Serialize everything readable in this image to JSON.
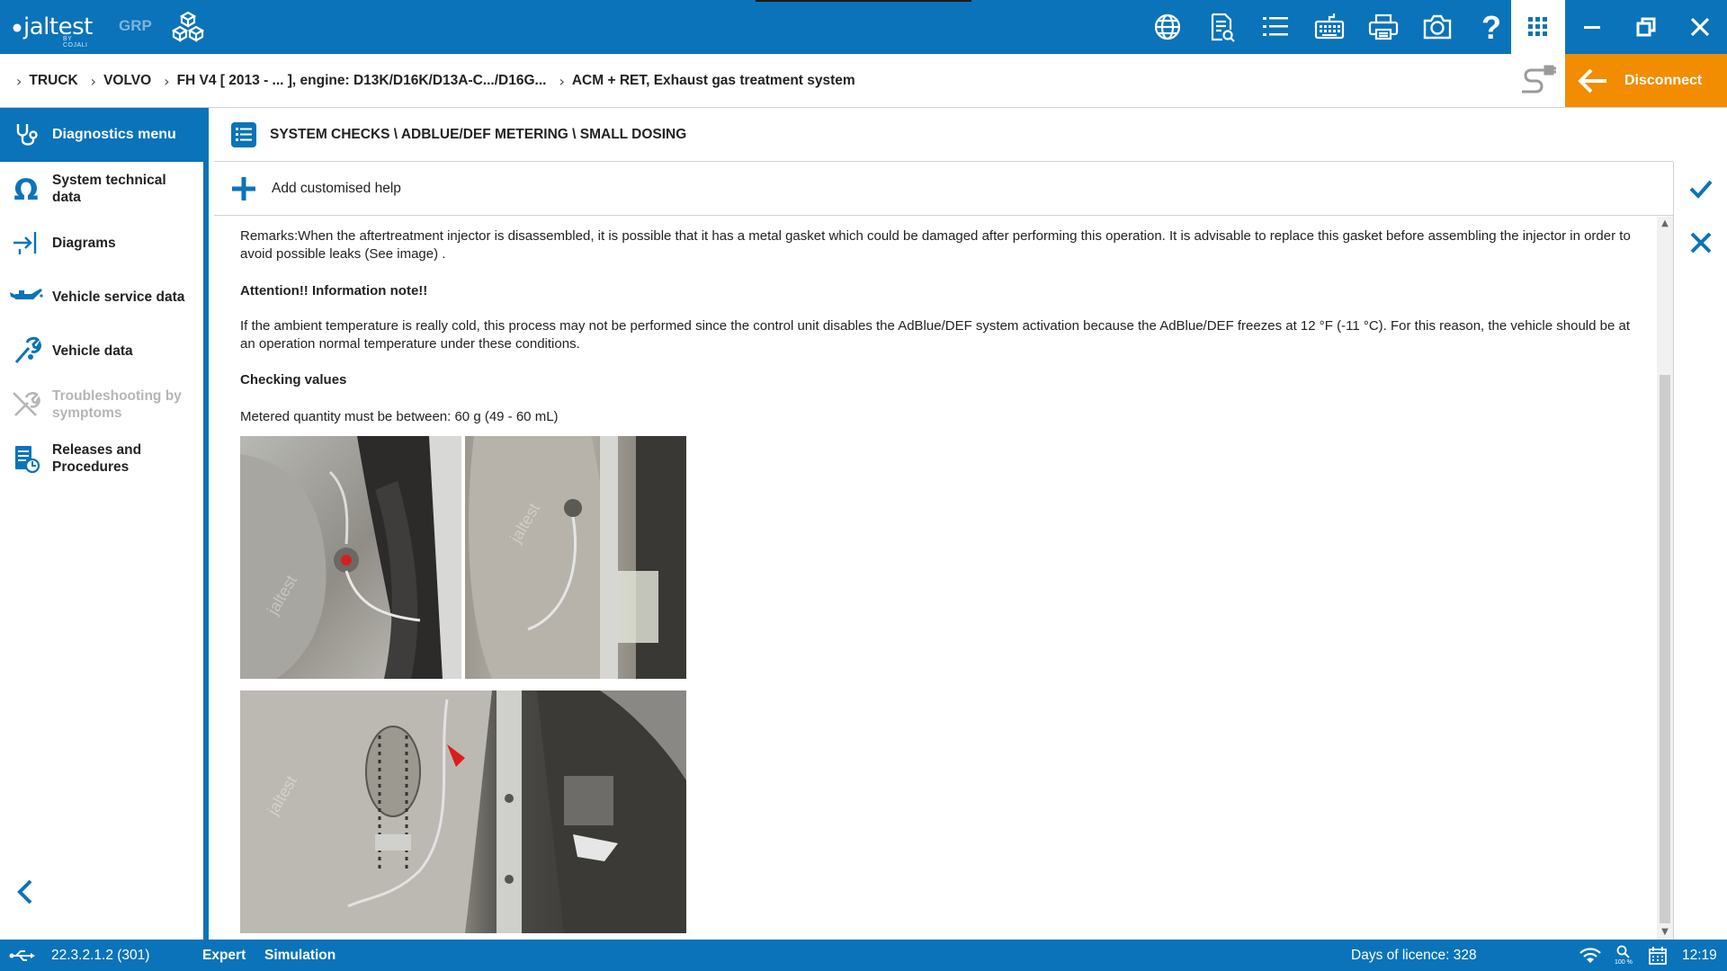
{
  "app": {
    "brand": "jaltest",
    "brand_sub": "BY COJALI",
    "product": "GRP"
  },
  "toolbar": {
    "tools": [
      "globe-icon",
      "document-search-icon",
      "list-icon",
      "keyboard-icon",
      "printer-icon",
      "camera-icon",
      "help-icon"
    ],
    "apps": "grid-icon",
    "window": [
      "minimize-icon",
      "restore-icon",
      "close-icon"
    ]
  },
  "breadcrumb": {
    "items": [
      "TRUCK",
      "VOLVO",
      "FH V4 [ 2013 - ... ], engine: D13K/D16K/D13A-C.../D16G...",
      "ACM + RET, Exhaust gas treatment system"
    ],
    "disconnect_label": "Disconnect"
  },
  "sidebar": {
    "header": "Diagnostics menu",
    "items": [
      {
        "label": "System technical data",
        "icon": "omega-icon",
        "enabled": true
      },
      {
        "label": "Diagrams",
        "icon": "diagram-arrow-icon",
        "enabled": true
      },
      {
        "label": "Vehicle service data",
        "icon": "oil-can-icon",
        "enabled": true
      },
      {
        "label": "Vehicle data",
        "icon": "wrench-icon",
        "enabled": true
      },
      {
        "label": "Troubleshooting by symptoms",
        "icon": "tools-icon",
        "enabled": false
      },
      {
        "label": "Releases and Procedures",
        "icon": "procedures-icon",
        "enabled": true
      }
    ]
  },
  "content": {
    "title": "SYSTEM CHECKS \\ ADBLUE/DEF METERING \\ SMALL DOSING",
    "add_help": "Add customised help",
    "remarks": "Remarks:When the aftertreatment injector is disassembled, it is possible that it has a metal gasket which could be damaged after performing this operation. It is advisable to replace this gasket before assembling the injector in order to avoid possible leaks (See image) .",
    "attention": "Attention!! Information note!!",
    "info": "If the ambient temperature is really cold, this process may not be performed since the control unit disables the AdBlue/DEF system activation because the AdBlue/DEF freezes at 12 °F (-11 °C). For this reason, the vehicle should be at an operation normal temperature under these conditions.",
    "checking_title": "Checking values",
    "metered": "Metered quantity must be between: 60 g (49 - 60 mL)",
    "watermark": "jaltest"
  },
  "status": {
    "version": "22.3.2.1.2 (301)",
    "mode": "Expert",
    "simulation": "Simulation",
    "licence": "Days of licence: 328",
    "zoom": "100 %",
    "time": "12:19"
  },
  "colors": {
    "primary": "#0a73ba",
    "accent": "#f28c00"
  }
}
